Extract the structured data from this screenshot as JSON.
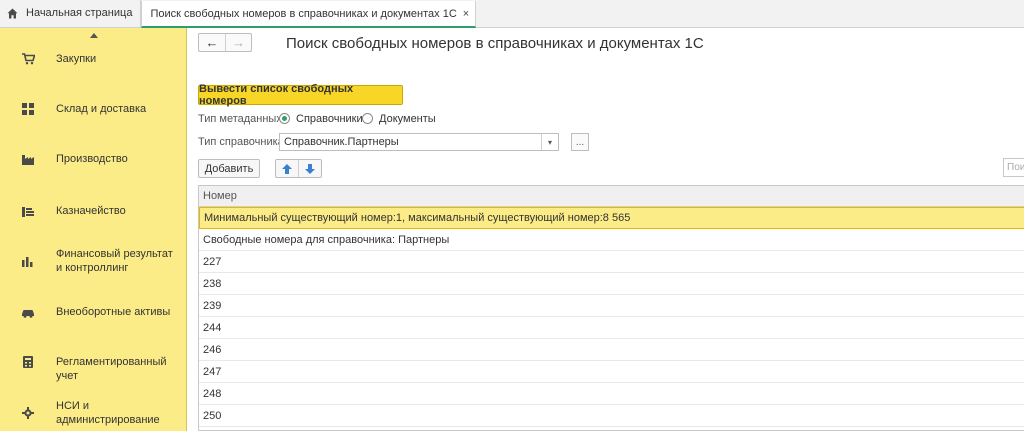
{
  "tabs": {
    "home_label": "Начальная страница",
    "active_label": "Поиск свободных номеров в  справочниках и документах 1С",
    "close_glyph": "×"
  },
  "sidebar": {
    "items": [
      {
        "label": "Закупки",
        "icon": "cart-icon"
      },
      {
        "label": "Склад и доставка",
        "icon": "warehouse-icon"
      },
      {
        "label": "Производство",
        "icon": "factory-icon"
      },
      {
        "label": "Казначейство",
        "icon": "coins-icon"
      },
      {
        "label": "Финансовый результат и контроллинг",
        "icon": "bar-chart-icon"
      },
      {
        "label": "Внеоборотные активы",
        "icon": "car-icon"
      },
      {
        "label": "Регламентированный учет",
        "icon": "calculator-icon"
      },
      {
        "label": "НСИ и администрирование",
        "icon": "gear-icon"
      }
    ]
  },
  "header": {
    "title": "Поиск свободных номеров в  справочниках и документах 1С",
    "back_glyph": "←",
    "forward_glyph": "→"
  },
  "form": {
    "primary_button": "Вывести список свободных номеров",
    "metadata_type_label": "Тип метаданных:",
    "radio_catalogs": "Справочники",
    "radio_documents": "Документы",
    "selected_metadata_type": "Справочники",
    "catalog_type_label": "Тип справочника:",
    "catalog_type_value": "Справочник.Партнеры",
    "select_more": "...",
    "add_button": "Добавить",
    "search_placeholder": "Пои"
  },
  "table": {
    "column_header": "Номер",
    "rows": [
      "Минимальный существующий номер:1, максимальный существующий номер:8 565",
      "Свободные номера для справочника: Партнеры",
      "227",
      "238",
      "239",
      "244",
      "246",
      "247",
      "248",
      "250"
    ],
    "selected_row_index": 0
  },
  "colors": {
    "sidebar_bg": "#fbec88",
    "primary_button": "#f7d627",
    "accent_green": "#2e9e6b",
    "arrow_blue": "#3b7fd0"
  }
}
